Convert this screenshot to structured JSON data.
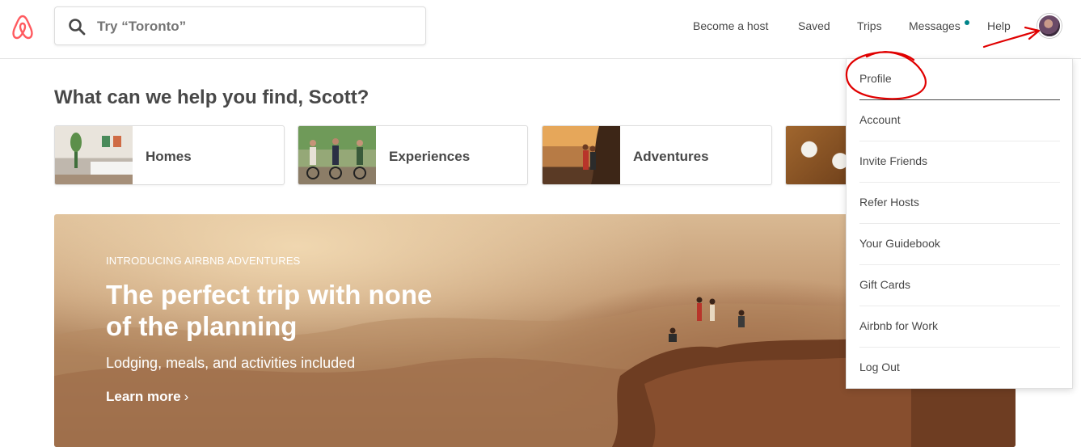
{
  "header": {
    "search_placeholder": "Try “Toronto”",
    "nav": {
      "become_host": "Become a host",
      "saved": "Saved",
      "trips": "Trips",
      "messages": "Messages",
      "help": "Help"
    }
  },
  "main": {
    "greeting": "What can we help you find, Scott?",
    "categories": [
      {
        "label": "Homes"
      },
      {
        "label": "Experiences"
      },
      {
        "label": "Adventures"
      },
      {
        "label": ""
      }
    ]
  },
  "hero": {
    "eyebrow": "INTRODUCING AIRBNB ADVENTURES",
    "title": "The perfect trip with none of the planning",
    "subtitle": "Lodging, meals, and activities included",
    "cta": "Learn more",
    "cta_chevron": "›"
  },
  "menu": {
    "items": [
      {
        "label": "Profile"
      },
      {
        "label": "Account"
      },
      {
        "label": "Invite Friends"
      },
      {
        "label": "Refer Hosts"
      },
      {
        "label": "Your Guidebook"
      },
      {
        "label": "Gift Cards"
      },
      {
        "label": "Airbnb for Work"
      },
      {
        "label": "Log Out"
      }
    ]
  },
  "colors": {
    "brand": "#FF5A5F",
    "text": "#484848",
    "notification_dot": "#008489",
    "annotation": "#E00000"
  },
  "icons": {
    "logo": "airbnb-belo-logo",
    "search": "search-icon",
    "avatar": "user-avatar",
    "chevron": "chevron-right-icon"
  }
}
